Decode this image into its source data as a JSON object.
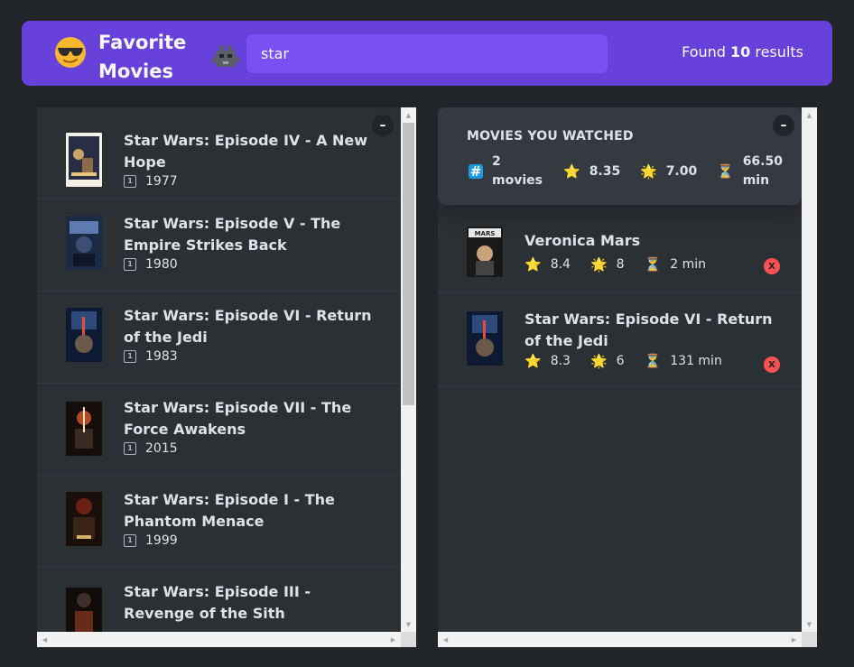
{
  "nav": {
    "logo_text": "Favorite Movies",
    "search_value": "star",
    "search_placeholder": "Search movies...",
    "results_prefix": "Found",
    "results_count": "10",
    "results_suffix": "results"
  },
  "left": {
    "toggle": "–",
    "movies": [
      {
        "title": "Star Wars: Episode IV - A New Hope",
        "year": "1977"
      },
      {
        "title": "Star Wars: Episode V - The Empire Strikes Back",
        "year": "1980"
      },
      {
        "title": "Star Wars: Episode VI - Return of the Jedi",
        "year": "1983"
      },
      {
        "title": "Star Wars: Episode VII - The Force Awakens",
        "year": "2015"
      },
      {
        "title": "Star Wars: Episode I - The Phantom Menace",
        "year": "1999"
      },
      {
        "title": "Star Wars: Episode III - Revenge of the Sith",
        "year": ""
      }
    ]
  },
  "right": {
    "toggle": "–",
    "summary": {
      "title": "MOVIES YOU WATCHED",
      "count": "2 movies",
      "imdb_avg": "8.35",
      "user_avg": "7.00",
      "runtime_avg": "66.50 min"
    },
    "watched": [
      {
        "title": "Veronica Mars",
        "imdb": "8.4",
        "user": "8",
        "runtime": "2 min",
        "delete": "X"
      },
      {
        "title": "Star Wars: Episode VI - Return of the Jedi",
        "imdb": "8.3",
        "user": "6",
        "runtime": "131 min",
        "delete": "X"
      }
    ]
  },
  "colors": {
    "nav_bg": "#6741d9",
    "search_bg": "#7950f2",
    "box_bg": "#2b3035",
    "summary_bg": "#343a40",
    "page_bg": "#212529",
    "delete_red": "#fa5252"
  }
}
